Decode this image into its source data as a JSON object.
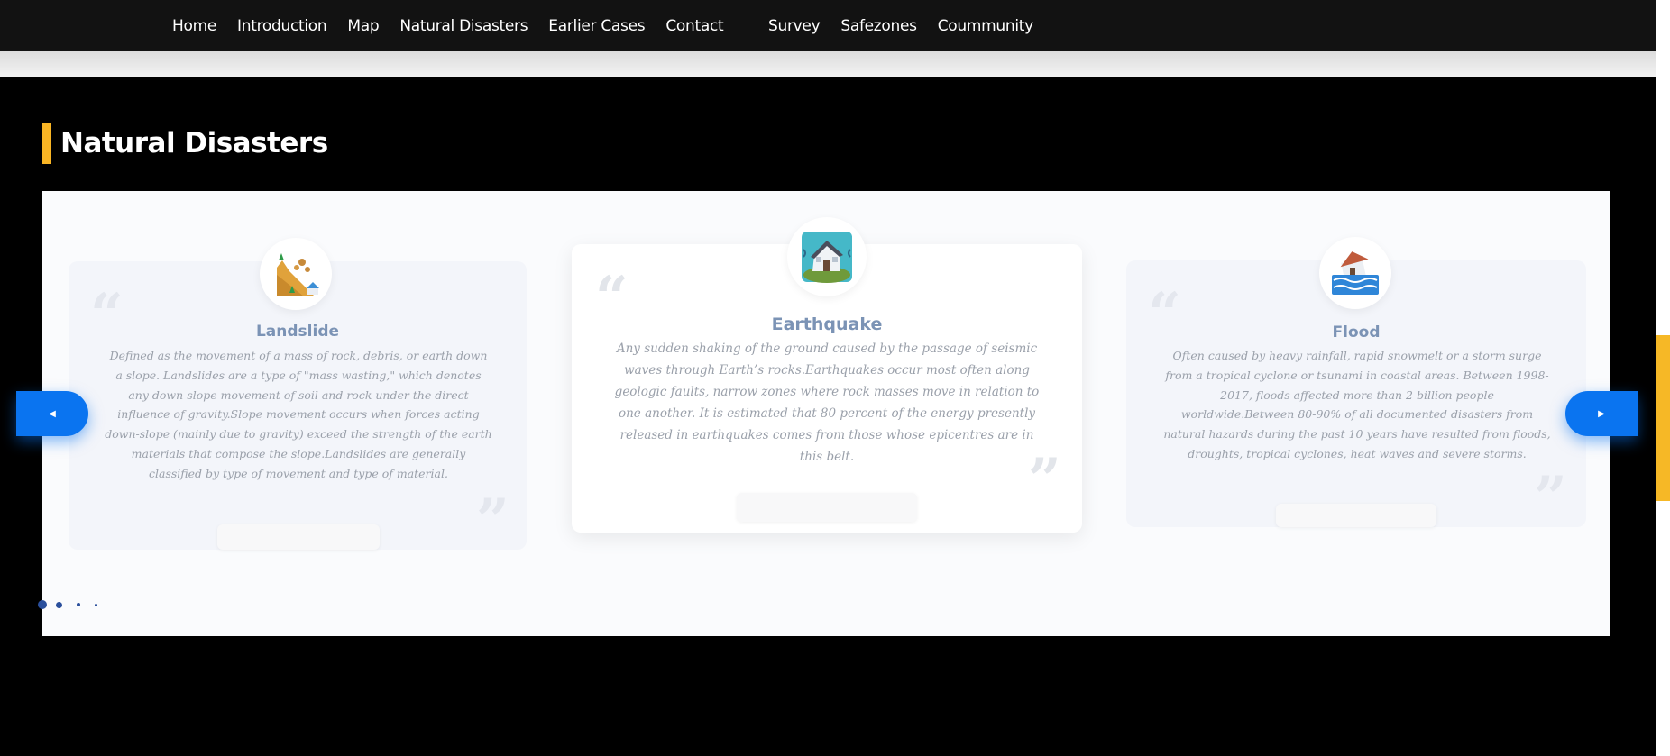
{
  "nav": {
    "left": [
      "Home",
      "Introduction",
      "Map",
      "Natural Disasters",
      "Earlier Cases",
      "Contact"
    ],
    "right": [
      "Survey",
      "Safezones",
      "Coummunity"
    ]
  },
  "section": {
    "title": "Natural Disasters"
  },
  "cards": [
    {
      "title": "Landslide",
      "icon": "landslide-icon",
      "text": "Defined as the movement of a mass of rock, debris, or earth down a slope. Landslides are a type of \"mass wasting,\" which denotes any down-slope movement of soil and rock under the direct influence of gravity.Slope movement occurs when forces acting down-slope (mainly due to gravity) exceed the strength of the earth materials that compose the slope.Landslides are generally classified by type of movement and type of material."
    },
    {
      "title": "Earthquake",
      "icon": "earthquake-icon",
      "text": "Any sudden shaking of the ground caused by the passage of seismic waves through Earth’s rocks.Earthquakes occur most often along geologic faults, narrow zones where rock masses move in relation to one another. It is estimated that 80 percent of the energy presently released in earthquakes comes from those whose epicentres are in this belt."
    },
    {
      "title": "Flood",
      "icon": "flood-icon",
      "text": "Often caused by heavy rainfall, rapid snowmelt or a storm surge from a tropical cyclone or tsunami in coastal areas. Between 1998-2017, floods affected more than 2 billion people worldwide.Between 80-90% of all documented disasters from natural hazards during the past 10 years have resulted from floods, droughts, tropical cyclones, heat waves and severe storms."
    }
  ],
  "carousel": {
    "prev_icon": "caret-left-icon",
    "next_icon": "caret-right-icon",
    "page_count": 4,
    "active_page": 1
  },
  "colors": {
    "accent": "#f9b524",
    "button": "#0a74f0",
    "title": "#7b93b5",
    "dot": "#2a4f9c"
  }
}
